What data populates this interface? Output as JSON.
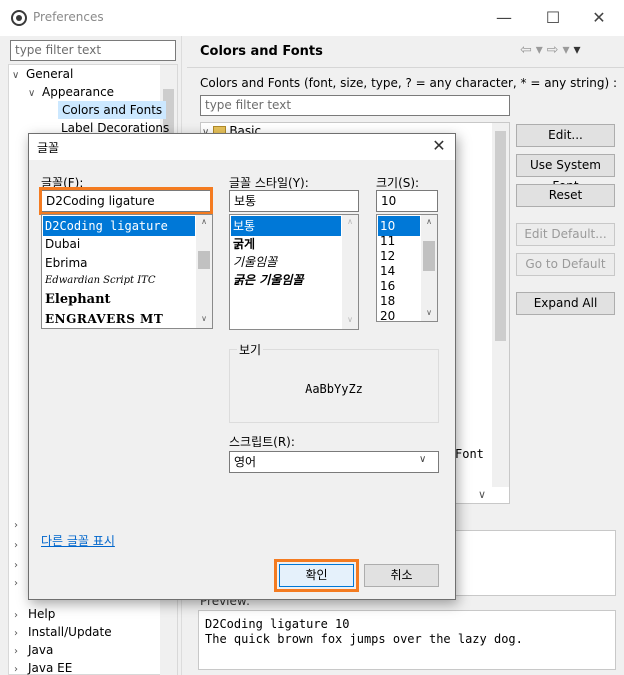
{
  "preferences": {
    "window_title": "Preferences",
    "left_filter_placeholder": "type filter text",
    "tree_items": [
      {
        "label": "General",
        "expanded": true
      },
      {
        "label": "Appearance",
        "expanded": true
      },
      {
        "label": "Colors and Fonts",
        "selected": true
      },
      {
        "label": "Label Decorations"
      },
      {
        "label": "Help"
      },
      {
        "label": "Install/Update"
      },
      {
        "label": "Java"
      },
      {
        "label": "Java EE"
      }
    ],
    "right_title": "Colors and Fonts",
    "right_description": "Colors and Fonts (font, size, type, ? = any character, * = any string) :",
    "right_filter_placeholder": "type filter text",
    "basic_node": "Basic",
    "tree_font_suffix": "Font",
    "buttons": {
      "edit": "Edit...",
      "use_system_font": "Use System Font",
      "reset": "Reset",
      "edit_default": "Edit Default...",
      "go_to_default": "Go to Default",
      "expand_all": "Expand All"
    },
    "preview_label": "Preview:",
    "preview_lines": [
      "D2Coding ligature 10",
      "The quick brown fox jumps over the lazy dog."
    ]
  },
  "font_dialog": {
    "title": "글꼴",
    "font_label": "글꼴(F):",
    "font_value": "D2Coding ligature",
    "font_list": [
      "D2Coding ligature",
      "Dubai",
      "Ebrima",
      "Edwardian Script ITC",
      "Elephant",
      "ENGRAVERS MT"
    ],
    "style_label": "글꼴 스타일(Y):",
    "style_value": "보통",
    "style_list": [
      "보통",
      "굵게",
      "기울임꼴",
      "굵은 기울임꼴"
    ],
    "size_label": "크기(S):",
    "size_value": "10",
    "size_list": [
      "10",
      "11",
      "12",
      "14",
      "16",
      "18",
      "20"
    ],
    "sample_label": "보기",
    "sample_text": "AaBbYyZz",
    "script_label": "스크립트(R):",
    "script_value": "영어",
    "more_fonts_link": "다른 글꼴 표시",
    "ok_button": "확인",
    "cancel_button": "취소"
  },
  "colors": {
    "highlight": "#f47b20",
    "selection": "#0078d7"
  }
}
